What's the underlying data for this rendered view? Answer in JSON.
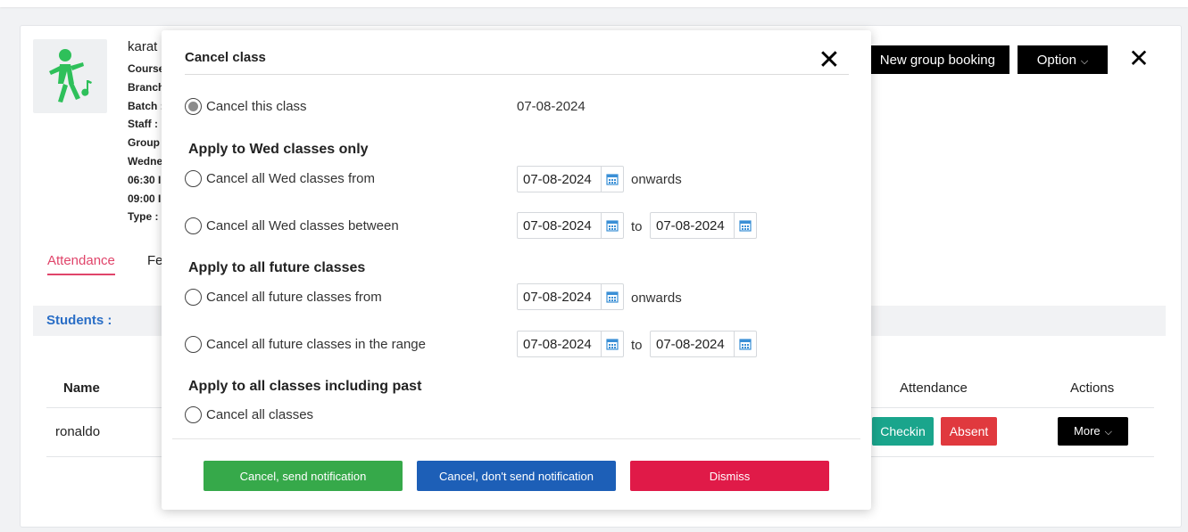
{
  "colors": {
    "accent_tab": "#e0446a",
    "students_label": "#2a6ec6",
    "checkin": "#1aa58c",
    "absent": "#e0393e",
    "notify": "#36a94a",
    "no_notify": "#1d5fb7",
    "dismiss": "#e01a48",
    "avatar_figure": "#2ec05a",
    "calendar_icon": "#3a8fd6"
  },
  "class_info": {
    "title": "karat",
    "lines": [
      "Course",
      "Branch",
      "Batch :",
      "Staff :",
      "Group",
      "Wedne",
      "06:30 I",
      "09:00 I",
      "Type :"
    ],
    "avatar_icon": "dancing-figure-icon"
  },
  "header": {
    "new_group_booking": "New group booking",
    "option": "Option",
    "option_icon": "chevron-down-icon",
    "close_icon": "close-icon"
  },
  "tabs": {
    "attendance": "Attendance",
    "fe": "Fe"
  },
  "students": {
    "label": "Students :",
    "columns": {
      "name": "Name",
      "attendance": "Attendance",
      "actions": "Actions"
    },
    "rows": [
      {
        "name": "ronaldo",
        "checkin": "Checkin",
        "absent": "Absent",
        "more": "More"
      }
    ]
  },
  "modal": {
    "title": "Cancel class",
    "close_icon": "close-icon",
    "cancel_this_class": {
      "label": "Cancel this class",
      "date": "07-08-2024",
      "selected": true
    },
    "section_wed": "Apply to Wed classes only",
    "wed_from": {
      "label": "Cancel all Wed classes from",
      "date": "07-08-2024",
      "suffix": "onwards"
    },
    "wed_between": {
      "label": "Cancel all Wed classes between",
      "from": "07-08-2024",
      "to_label": "to",
      "to": "07-08-2024"
    },
    "section_future": "Apply to all future classes",
    "future_from": {
      "label": "Cancel all future classes from",
      "date": "07-08-2024",
      "suffix": "onwards"
    },
    "future_range": {
      "label": "Cancel all future classes in the range",
      "from": "07-08-2024",
      "to_label": "to",
      "to": "07-08-2024"
    },
    "section_all": "Apply to all classes including past",
    "cancel_all": {
      "label": "Cancel all classes"
    },
    "buttons": {
      "notify": "Cancel, send notification",
      "no_notify": "Cancel, don't send notification",
      "dismiss": "Dismiss"
    }
  }
}
